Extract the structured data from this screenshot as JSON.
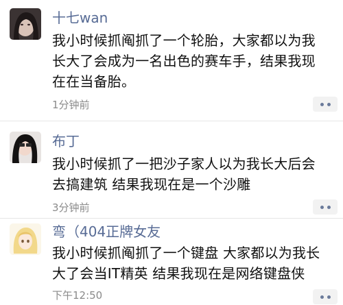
{
  "comments": [
    {
      "username": "十七wan",
      "lines": [
        "我小时候抓阄抓了一个轮胎，大家都以为我",
        "长大了会成为一名出色的赛车手，结果我现",
        "在在当备胎。"
      ],
      "time": "1分钟前"
    },
    {
      "username": "布丁",
      "lines": [
        "我小时候抓了一把沙子家人以为我长大后会",
        "去搞建筑 结果我现在是一个沙雕"
      ],
      "time": "3分钟前"
    },
    {
      "username": "弯（404正牌女友",
      "lines": [
        "我小时候抓阄抓了一个键盘 大家都以为我长",
        "大了会当IT精英 结果我现在是网络键盘侠"
      ],
      "time": "下午12:50"
    }
  ],
  "colors": {
    "username": "#576b95",
    "time": "#8a8a8a",
    "more_button_bg": "#f2f2f2"
  },
  "icons": {
    "more": "more-dots-icon"
  }
}
